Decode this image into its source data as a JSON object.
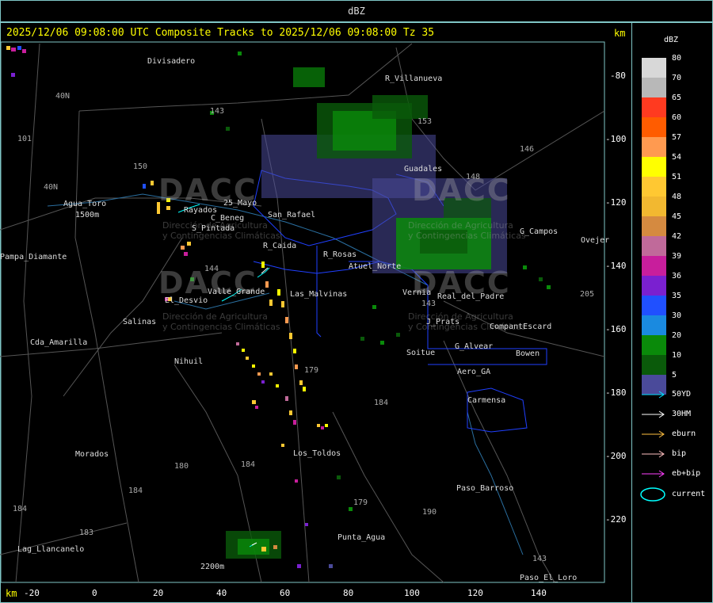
{
  "window": {
    "title": "dBZ"
  },
  "map": {
    "header": "2025/12/06 09:08:00 UTC Composite Tracks to 2025/12/06 09:08:00 Tz 35",
    "km_top": "km",
    "km_bottom": "km",
    "y_ticks": [
      "-80",
      "-100",
      "-120",
      "-140",
      "-160",
      "-180",
      "-200",
      "-220"
    ],
    "x_ticks": [
      "-20",
      "0",
      "20",
      "40",
      "60",
      "80",
      "100",
      "120",
      "140"
    ],
    "places": [
      "Divisadero",
      "R_Villanueva",
      "Guadales",
      "Agua_Toro",
      "1500m",
      "Pampa_Diamante",
      "San_Rafael",
      "C_Beneg",
      "R_Caida",
      "Las_Malvinas",
      "Atuel_Norte",
      "Real_del_Padre",
      "G_Campos",
      "Valle_Grande",
      "El_Desvio",
      "Salinas",
      "Cda_Amarilla",
      "Nihuil",
      "Soitue",
      "G_Alvear",
      "Aero_GA",
      "Bowen",
      "CompantEscard",
      "J_Prats",
      "Carmensa",
      "Morados",
      "Los_Toldos",
      "Paso_Barroso",
      "Punta_Agua",
      "Lag_Llancanelo",
      "2200m",
      "Paso_El_Loro",
      "Ovejer",
      "Rayados",
      "S_Pintada",
      "25_Mayo",
      "R_Rosas",
      "Vernia"
    ],
    "routes": [
      "143",
      "153",
      "146",
      "148",
      "40N",
      "101",
      "150",
      "40N",
      "144",
      "143",
      "205",
      "179",
      "184",
      "184",
      "180",
      "184",
      "179",
      "190",
      "143",
      "183",
      "184"
    ],
    "watermark": {
      "main": "DACC",
      "sub1": "Dirección de Agricultura",
      "sub2": "y Contingencias Climáticas"
    },
    "colors": {
      "track_cyan": "#00ffff",
      "boundary_blue": "#2040ff",
      "frame": "#7fc6c6",
      "header": "#ffff00"
    }
  },
  "legend": {
    "title": "dBZ",
    "scale": [
      {
        "value": "80",
        "color": "#d8d8d8"
      },
      {
        "value": "70",
        "color": "#b8b8b8"
      },
      {
        "value": "65",
        "color": "#ff3a20"
      },
      {
        "value": "60",
        "color": "#ff5c00"
      },
      {
        "value": "57",
        "color": "#ff9a50"
      },
      {
        "value": "54",
        "color": "#ffff00"
      },
      {
        "value": "51",
        "color": "#ffc832"
      },
      {
        "value": "48",
        "color": "#f2b830"
      },
      {
        "value": "45",
        "color": "#d58a40"
      },
      {
        "value": "42",
        "color": "#c06a9a"
      },
      {
        "value": "39",
        "color": "#c81e9c"
      },
      {
        "value": "36",
        "color": "#7a20d0"
      },
      {
        "value": "35",
        "color": "#2050ff"
      },
      {
        "value": "30",
        "color": "#1a8ae0"
      },
      {
        "value": "20",
        "color": "#0a8a0a"
      },
      {
        "value": "10",
        "color": "#0a5a0a"
      },
      {
        "value": "5",
        "color": "#4a4a9a"
      }
    ],
    "tracks": [
      {
        "label": "50YD",
        "color": "#00e0ff"
      },
      {
        "label": "30HM",
        "color": "#ffffff"
      },
      {
        "label": "eburn",
        "color": "#ffc040"
      },
      {
        "label": "bip",
        "color": "#ffc0c0"
      },
      {
        "label": "eb+bip",
        "color": "#ff40ff"
      }
    ],
    "current_label": "current"
  }
}
